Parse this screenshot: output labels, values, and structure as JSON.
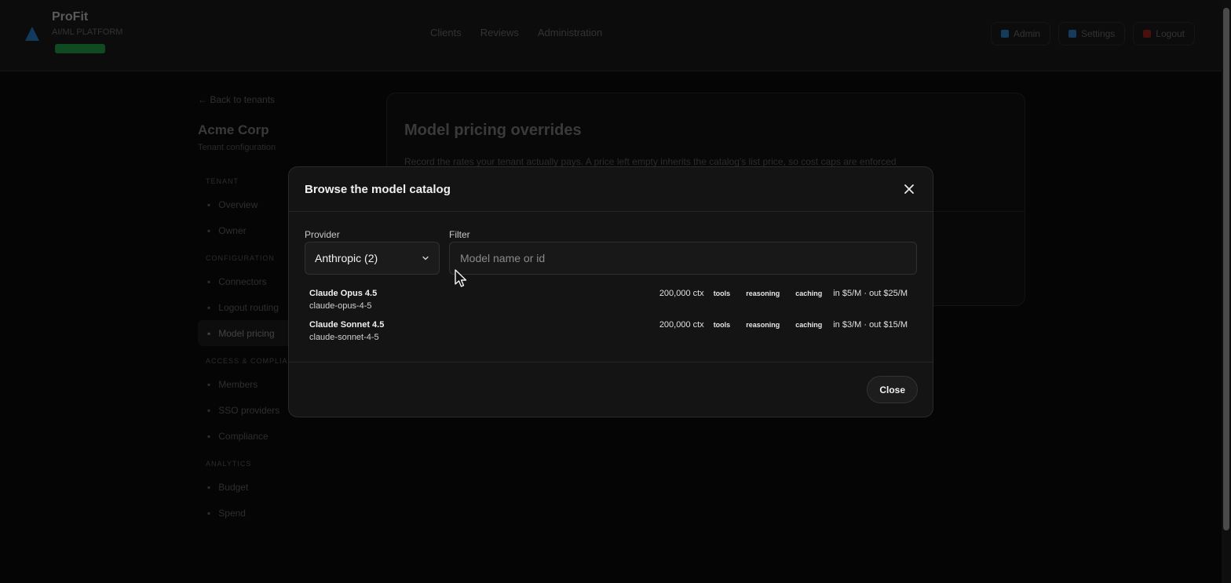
{
  "app": {
    "brand_name": "ProFit",
    "brand_subtitle": "AI/ML PLATFORM",
    "nav": [
      "Clients",
      "Reviews",
      "Administration"
    ],
    "top_right": [
      {
        "label": "Admin",
        "color": "#1f4f7a"
      },
      {
        "label": "Settings",
        "color": "#1f4f7a"
      },
      {
        "label": "Logout",
        "color": "#6a1616"
      }
    ]
  },
  "sidebar": {
    "back_label": "Back to tenants",
    "tenant_name": "Acme Corp",
    "tenant_subtitle": "Tenant configuration",
    "groups": [
      {
        "title": "TENANT",
        "items": [
          "Overview",
          "Owner"
        ]
      },
      {
        "title": "CONFIGURATION",
        "items": [
          "Connectors",
          "Logout routing",
          "Model pricing"
        ]
      },
      {
        "title": "ACCESS & COMPLIANCE",
        "items": [
          "Members",
          "SSO providers",
          "Compliance"
        ]
      },
      {
        "title": "ANALYTICS",
        "items": [
          "Budget",
          "Spend"
        ]
      }
    ],
    "active_item": "Model pricing"
  },
  "main": {
    "title": "Model pricing overrides",
    "description": "Record the rates your tenant actually pays. A price left empty inherits the catalog's list price, so cost caps are enforced"
  },
  "modal": {
    "title": "Browse the model catalog",
    "provider_label": "Provider",
    "provider_value": "Anthropic (2)",
    "filter_label": "Filter",
    "filter_value": "",
    "filter_placeholder": "Model name or id",
    "models": [
      {
        "name": "Claude Opus 4.5",
        "id": "claude-opus-4-5",
        "context": "200,000 ctx",
        "tags": [
          "tools",
          "reasoning",
          "caching"
        ],
        "price": "in $5/M · out $25/M"
      },
      {
        "name": "Claude Sonnet 4.5",
        "id": "claude-sonnet-4-5",
        "context": "200,000 ctx",
        "tags": [
          "tools",
          "reasoning",
          "caching"
        ],
        "price": "in $3/M · out $15/M"
      }
    ],
    "close_label": "Close"
  }
}
